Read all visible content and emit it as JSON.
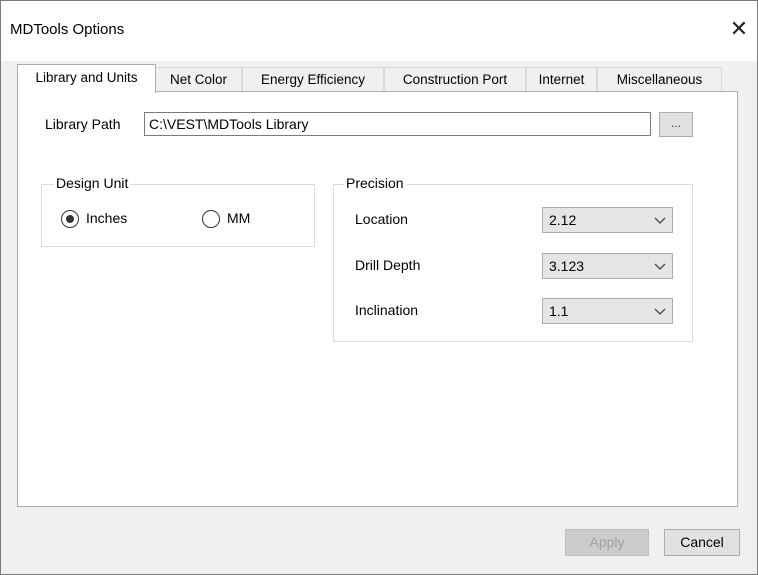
{
  "window": {
    "title": "MDTools Options",
    "close_glyph": "✕"
  },
  "tabs": [
    {
      "label": "Library and Units",
      "active": true
    },
    {
      "label": "Net Color"
    },
    {
      "label": "Energy Efficiency"
    },
    {
      "label": "Construction Port"
    },
    {
      "label": "Internet"
    },
    {
      "label": "Miscellaneous"
    }
  ],
  "library": {
    "label": "Library Path",
    "value": "C:\\VEST\\MDTools Library",
    "browse_label": "..."
  },
  "design_unit": {
    "legend": "Design Unit",
    "options": [
      {
        "label": "Inches",
        "selected": true
      },
      {
        "label": "MM",
        "selected": false
      }
    ]
  },
  "precision": {
    "legend": "Precision",
    "rows": [
      {
        "label": "Location",
        "value": "2.12"
      },
      {
        "label": "Drill Depth",
        "value": "3.123"
      },
      {
        "label": "Inclination",
        "value": "1.1"
      }
    ]
  },
  "buttons": {
    "apply": "Apply",
    "cancel": "Cancel"
  },
  "icons": {
    "close": "close-icon",
    "dropdown": "chevron-down-icon"
  }
}
